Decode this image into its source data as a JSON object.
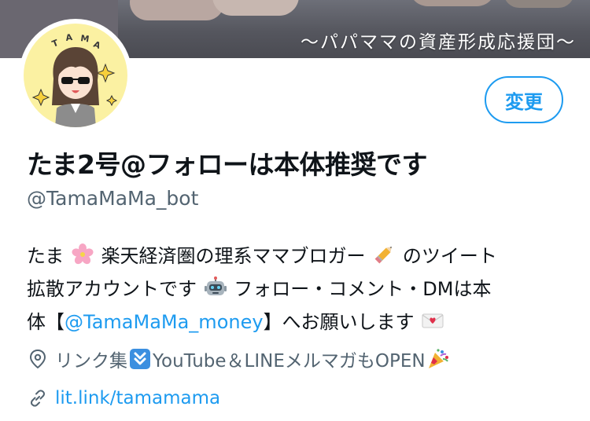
{
  "banner": {
    "tagline": "〜パパママの資産形成応援団〜"
  },
  "avatar": {
    "letters": [
      "T",
      "A",
      "M",
      "A"
    ]
  },
  "edit_button": {
    "label": "変更"
  },
  "profile": {
    "display_name": "たま2号@フォローは本体推奨です",
    "handle": "@TamaMaMa_bot"
  },
  "bio": {
    "line1_a": "たま",
    "line1_b": "楽天経済圏の理系ママブロガー",
    "line1_c": " のツイート",
    "line2_a": "拡散アカウントです",
    "line2_b": " フォロー・コメント・DMは本",
    "line3_a": "体【",
    "line3_mention": "@TamaMaMa_money",
    "line3_b": "】へお願いします"
  },
  "location": {
    "text_a": "リンク集",
    "text_b": "YouTube＆LINEメルマガもOPEN"
  },
  "website": {
    "text": "lit.link/tamamama"
  },
  "icons": {
    "bio": [
      "cherry-blossom-icon",
      "pencil-icon",
      "robot-icon",
      "love-letter-icon"
    ],
    "location": [
      "location-pin-icon",
      "down-arrow-button-icon",
      "party-popper-icon"
    ],
    "website": "link-icon"
  },
  "colors": {
    "accent": "#1d9bf0",
    "text": "#0f1419",
    "muted": "#536471",
    "avatar_bg": "#fbf1a2"
  }
}
